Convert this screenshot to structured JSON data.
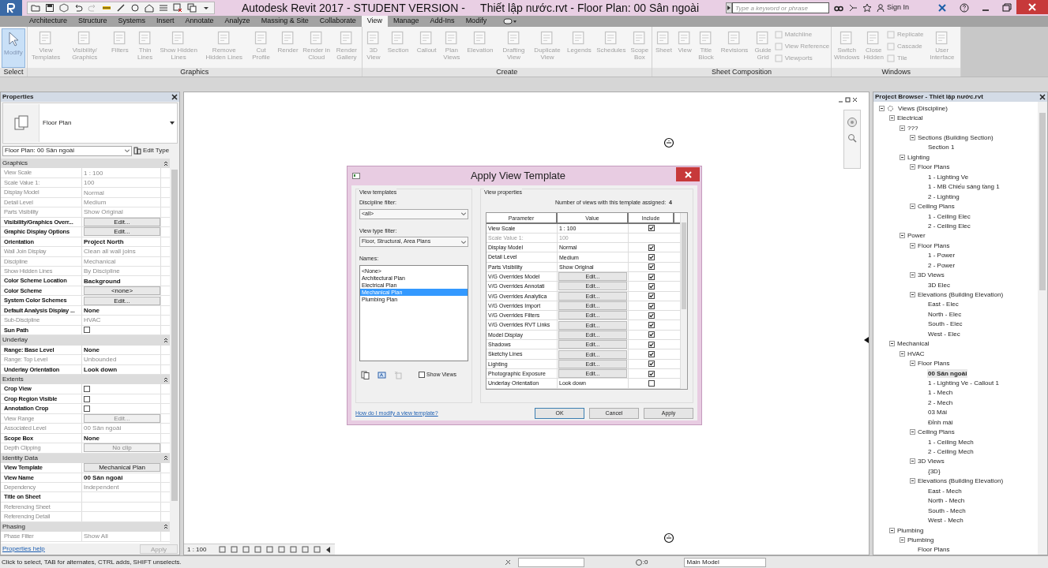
{
  "title_bar": {
    "title": "Autodesk Revit 2017 - STUDENT VERSION -     Thiết lập nước.rvt - Floor Plan: 00 Sân ngoài",
    "search_placeholder": "Type a keyword or phrase",
    "sign_in": "Sign In"
  },
  "tabs": [
    {
      "label": "Architecture",
      "selected": false
    },
    {
      "label": "Structure",
      "selected": false
    },
    {
      "label": "Systems",
      "selected": false
    },
    {
      "label": "Insert",
      "selected": false
    },
    {
      "label": "Annotate",
      "selected": false
    },
    {
      "label": "Analyze",
      "selected": false
    },
    {
      "label": "Massing & Site",
      "selected": false
    },
    {
      "label": "Collaborate",
      "selected": false
    },
    {
      "label": "View",
      "selected": true
    },
    {
      "label": "Manage",
      "selected": false
    },
    {
      "label": "Add-Ins",
      "selected": false
    },
    {
      "label": "Modify",
      "selected": false
    }
  ],
  "ribbon": [
    {
      "label": "Select",
      "tools": [
        {
          "label": "Modify",
          "kind": "large",
          "disabled": false,
          "selected": true
        }
      ]
    },
    {
      "label": "Graphics",
      "tools": [
        {
          "label": "View Templates",
          "kind": "large",
          "disabled": true,
          "selected": false
        },
        {
          "label": "Visibility/ Graphics",
          "kind": "large",
          "disabled": true,
          "selected": false
        },
        {
          "label": "Filters",
          "kind": "large",
          "disabled": true,
          "selected": false
        },
        {
          "label": "Thin Lines",
          "kind": "large",
          "disabled": true,
          "selected": false
        },
        {
          "label": "Show Hidden Lines",
          "kind": "large",
          "disabled": true,
          "selected": false
        },
        {
          "label": "Remove Hidden Lines",
          "kind": "large",
          "disabled": true,
          "selected": false
        },
        {
          "label": "Cut Profile",
          "kind": "large",
          "disabled": true,
          "selected": false
        },
        {
          "label": "Render",
          "kind": "large",
          "disabled": true,
          "selected": false
        },
        {
          "label": "Render in Cloud",
          "kind": "large",
          "disabled": true,
          "selected": false
        },
        {
          "label": "Render Gallery",
          "kind": "large",
          "disabled": true,
          "selected": false
        }
      ]
    },
    {
      "label": "Create",
      "tools": [
        {
          "label": "3D View",
          "kind": "large",
          "disabled": true,
          "selected": false
        },
        {
          "label": "Section",
          "kind": "large",
          "disabled": true,
          "selected": false
        },
        {
          "label": "Callout",
          "kind": "large",
          "disabled": true,
          "selected": false
        },
        {
          "label": "Plan Views",
          "kind": "large",
          "disabled": true,
          "selected": false
        },
        {
          "label": "Elevation",
          "kind": "large",
          "disabled": true,
          "selected": false
        },
        {
          "label": "Drafting View",
          "kind": "large",
          "disabled": true,
          "selected": false
        },
        {
          "label": "Duplicate View",
          "kind": "large",
          "disabled": true,
          "selected": false
        },
        {
          "label": "Legends",
          "kind": "large",
          "disabled": true,
          "selected": false
        },
        {
          "label": "Schedules",
          "kind": "large",
          "disabled": true,
          "selected": false
        },
        {
          "label": "Scope Box",
          "kind": "large",
          "disabled": true,
          "selected": false
        }
      ]
    },
    {
      "label": "Sheet Composition",
      "tools": [
        {
          "label": "Sheet",
          "kind": "large",
          "disabled": true,
          "selected": false
        },
        {
          "label": "View",
          "kind": "large",
          "disabled": true,
          "selected": false
        },
        {
          "label": "Title Block",
          "kind": "large",
          "disabled": true,
          "selected": false
        },
        {
          "label": "Revisions",
          "kind": "large",
          "disabled": true,
          "selected": false
        },
        {
          "label": "Guide Grid",
          "kind": "large",
          "disabled": true,
          "selected": false
        },
        {
          "label": "Matchline",
          "kind": "small",
          "disabled": true,
          "selected": false
        },
        {
          "label": "View Reference",
          "kind": "small",
          "disabled": true,
          "selected": false
        },
        {
          "label": "Viewports",
          "kind": "small",
          "disabled": true,
          "selected": false
        }
      ]
    },
    {
      "label": "Windows",
      "tools": [
        {
          "label": "Switch Windows",
          "kind": "large",
          "disabled": true,
          "selected": false
        },
        {
          "label": "Close Hidden",
          "kind": "large",
          "disabled": true,
          "selected": false
        },
        {
          "label": "Replicate",
          "kind": "small",
          "disabled": true,
          "selected": false
        },
        {
          "label": "Cascade",
          "kind": "small",
          "disabled": true,
          "selected": false
        },
        {
          "label": "Tile",
          "kind": "small",
          "disabled": true,
          "selected": false
        },
        {
          "label": "User Interface",
          "kind": "large",
          "disabled": true,
          "selected": false
        }
      ]
    }
  ],
  "properties": {
    "title": "Properties",
    "type_name": "Floor Plan",
    "instance": "Floor Plan: 00 Sân ngoài",
    "edit_type": "Edit Type",
    "help_link": "Properties help",
    "apply": "Apply",
    "groups": [
      {
        "name": "Graphics",
        "rows": [
          {
            "label": "View Scale",
            "value": "1 : 100",
            "kind": "text",
            "disabled": true
          },
          {
            "label": "Scale Value 1:",
            "value": "100",
            "kind": "text",
            "disabled": true
          },
          {
            "label": "Display Model",
            "value": "Normal",
            "kind": "text",
            "disabled": true
          },
          {
            "label": "Detail Level",
            "value": "Medium",
            "kind": "text",
            "disabled": true
          },
          {
            "label": "Parts Visibility",
            "value": "Show Original",
            "kind": "text",
            "disabled": true
          },
          {
            "label": "Visibility/Graphics Overr...",
            "value": "Edit...",
            "kind": "button",
            "disabled": false
          },
          {
            "label": "Graphic Display Options",
            "value": "Edit...",
            "kind": "button",
            "disabled": false
          },
          {
            "label": "Orientation",
            "value": "Project North",
            "kind": "text",
            "disabled": false
          },
          {
            "label": "Wall Join Display",
            "value": "Clean all wall joins",
            "kind": "text",
            "disabled": true
          },
          {
            "label": "Discipline",
            "value": "Mechanical",
            "kind": "text",
            "disabled": true
          },
          {
            "label": "Show Hidden Lines",
            "value": "By Discipline",
            "kind": "text",
            "disabled": true
          },
          {
            "label": "Color Scheme Location",
            "value": "Background",
            "kind": "text",
            "disabled": false
          },
          {
            "label": "Color Scheme",
            "value": "<none>",
            "kind": "button",
            "disabled": false
          },
          {
            "label": "System Color Schemes",
            "value": "Edit...",
            "kind": "button",
            "disabled": false
          },
          {
            "label": "Default Analysis Display ...",
            "value": "None",
            "kind": "text",
            "disabled": false
          },
          {
            "label": "Sub-Discipline",
            "value": "HVAC",
            "kind": "text",
            "disabled": true
          },
          {
            "label": "Sun Path",
            "kind": "checkbox",
            "checked": false,
            "disabled": false
          }
        ]
      },
      {
        "name": "Underlay",
        "rows": [
          {
            "label": "Range: Base Level",
            "value": "None",
            "kind": "text",
            "disabled": false
          },
          {
            "label": "Range: Top Level",
            "value": "Unbounded",
            "kind": "text",
            "disabled": true
          },
          {
            "label": "Underlay Orientation",
            "value": "Look down",
            "kind": "text",
            "disabled": false
          }
        ]
      },
      {
        "name": "Extents",
        "rows": [
          {
            "label": "Crop View",
            "kind": "checkbox",
            "checked": false,
            "disabled": false
          },
          {
            "label": "Crop Region Visible",
            "kind": "checkbox",
            "checked": false,
            "disabled": false
          },
          {
            "label": "Annotation Crop",
            "kind": "checkbox",
            "checked": false,
            "disabled": false
          },
          {
            "label": "View Range",
            "value": "Edit...",
            "kind": "button",
            "disabled": true
          },
          {
            "label": "Associated Level",
            "value": "00 Sân ngoài",
            "kind": "text",
            "disabled": true
          },
          {
            "label": "Scope Box",
            "value": "None",
            "kind": "text",
            "disabled": false
          },
          {
            "label": "Depth Clipping",
            "value": "No clip",
            "kind": "button",
            "disabled": true
          }
        ]
      },
      {
        "name": "Identity Data",
        "rows": [
          {
            "label": "View Template",
            "value": "Mechanical Plan",
            "kind": "button",
            "disabled": false
          },
          {
            "label": "View Name",
            "value": "00 Sân ngoài",
            "kind": "text",
            "disabled": false
          },
          {
            "label": "Dependency",
            "value": "Independent",
            "kind": "text",
            "disabled": true
          },
          {
            "label": "Title on Sheet",
            "kind": "text",
            "disabled": false
          },
          {
            "label": "Referencing Sheet",
            "kind": "text",
            "disabled": true
          },
          {
            "label": "Referencing Detail",
            "kind": "text",
            "disabled": true
          }
        ]
      },
      {
        "name": "Phasing",
        "rows": [
          {
            "label": "Phase Filter",
            "value": "Show All",
            "kind": "text",
            "disabled": true
          }
        ]
      }
    ]
  },
  "view_control_bar": {
    "scale": "1 : 100"
  },
  "dialog": {
    "title": "Apply View Template",
    "templates_group": "View templates",
    "discipline_label": "Discipline filter:",
    "discipline_value": "<all>",
    "view_type_label": "View type filter:",
    "view_type_value": "Floor, Structural, Area Plans",
    "names_label": "Names:",
    "names": [
      {
        "label": "<None>",
        "selected": false
      },
      {
        "label": "Architectural Plan",
        "selected": false
      },
      {
        "label": "Electrical Plan",
        "selected": false
      },
      {
        "label": "Mechanical Plan",
        "selected": true
      },
      {
        "label": "Plumbing Plan",
        "selected": false
      }
    ],
    "show_views": {
      "label": "Show Views",
      "checked": false
    },
    "properties_group": "View properties",
    "assigned_label": "Number of views with this template assigned:",
    "assigned_count": "4",
    "columns": [
      "Parameter",
      "Value",
      "Include"
    ],
    "rows": [
      {
        "parameter": "View Scale",
        "value": "1 : 100",
        "kind": "text",
        "disabled": false,
        "include": true
      },
      {
        "parameter": "Scale Value 1:",
        "value": "100",
        "kind": "text",
        "disabled": true
      },
      {
        "parameter": "Display Model",
        "value": "Normal",
        "kind": "text",
        "disabled": false,
        "include": true
      },
      {
        "parameter": "Detail Level",
        "value": "Medium",
        "kind": "text",
        "disabled": false,
        "include": true
      },
      {
        "parameter": "Parts Visibility",
        "value": "Show Original",
        "kind": "text",
        "disabled": false,
        "include": true
      },
      {
        "parameter": "V/G Overrides Model",
        "value": "Edit...",
        "kind": "button",
        "disabled": false,
        "include": true
      },
      {
        "parameter": "V/G Overrides Annotati",
        "value": "Edit...",
        "kind": "button",
        "disabled": false,
        "include": true
      },
      {
        "parameter": "V/G Overrides Analytica",
        "value": "Edit...",
        "kind": "button",
        "disabled": false,
        "include": true
      },
      {
        "parameter": "V/G Overrides Import",
        "value": "Edit...",
        "kind": "button",
        "disabled": false,
        "include": true
      },
      {
        "parameter": "V/G Overrides Filters",
        "value": "Edit...",
        "kind": "button",
        "disabled": false,
        "include": true
      },
      {
        "parameter": "V/G Overrides RVT Links",
        "value": "Edit...",
        "kind": "button",
        "disabled": false,
        "include": true
      },
      {
        "parameter": "Model Display",
        "value": "Edit...",
        "kind": "button",
        "disabled": false,
        "include": true
      },
      {
        "parameter": "Shadows",
        "value": "Edit...",
        "kind": "button",
        "disabled": false,
        "include": true
      },
      {
        "parameter": "Sketchy Lines",
        "value": "Edit...",
        "kind": "button",
        "disabled": false,
        "include": true
      },
      {
        "parameter": "Lighting",
        "value": "Edit...",
        "kind": "button",
        "disabled": false,
        "include": true
      },
      {
        "parameter": "Photographic Exposure",
        "value": "Edit...",
        "kind": "button",
        "disabled": false,
        "include": true
      },
      {
        "parameter": "Underlay Orientation",
        "value": "Look down",
        "kind": "text",
        "disabled": false,
        "include": false
      }
    ],
    "help_link": "How do I modify a view template?",
    "buttons": [
      "OK",
      "Cancel",
      "Apply"
    ]
  },
  "project_browser": {
    "title": "Project Browser - Thiết lập nước.rvt",
    "tree": [
      {
        "label": "Views (Discipline)",
        "selected": false,
        "children": [
          {
            "label": "Electrical",
            "selected": false,
            "children": [
              {
                "label": "???",
                "selected": false,
                "children": [
                  {
                    "label": "Sections (Building Section)",
                    "selected": false,
                    "children": [
                      {
                        "label": "Section 1",
                        "selected": false
                      }
                    ]
                  }
                ]
              },
              {
                "label": "Lighting",
                "selected": false,
                "children": [
                  {
                    "label": "Floor Plans",
                    "selected": false,
                    "children": [
                      {
                        "label": "1 - Lighting Ve",
                        "selected": false
                      },
                      {
                        "label": "1 - MB Chiếu sáng tầng 1",
                        "selected": false
                      },
                      {
                        "label": "2 - Lighting",
                        "selected": false
                      }
                    ]
                  },
                  {
                    "label": "Ceiling Plans",
                    "selected": false,
                    "children": [
                      {
                        "label": "1 - Ceiling Elec",
                        "selected": false
                      },
                      {
                        "label": "2 - Ceiling Elec",
                        "selected": false
                      }
                    ]
                  }
                ]
              },
              {
                "label": "Power",
                "selected": false,
                "children": [
                  {
                    "label": "Floor Plans",
                    "selected": false,
                    "children": [
                      {
                        "label": "1 - Power",
                        "selected": false
                      },
                      {
                        "label": "2 - Power",
                        "selected": false
                      }
                    ]
                  },
                  {
                    "label": "3D Views",
                    "selected": false,
                    "children": [
                      {
                        "label": "3D Elec",
                        "selected": false
                      }
                    ]
                  },
                  {
                    "label": "Elevations (Building Elevation)",
                    "selected": false,
                    "children": [
                      {
                        "label": "East - Elec",
                        "selected": false
                      },
                      {
                        "label": "North - Elec",
                        "selected": false
                      },
                      {
                        "label": "South - Elec",
                        "selected": false
                      },
                      {
                        "label": "West - Elec",
                        "selected": false
                      }
                    ]
                  }
                ]
              }
            ]
          },
          {
            "label": "Mechanical",
            "selected": false,
            "children": [
              {
                "label": "HVAC",
                "selected": false,
                "children": [
                  {
                    "label": "Floor Plans",
                    "selected": false,
                    "children": [
                      {
                        "label": "00 Sân ngoài",
                        "selected": true
                      },
                      {
                        "label": "1 - Lighting Ve - Callout 1",
                        "selected": false
                      },
                      {
                        "label": "1 - Mech",
                        "selected": false
                      },
                      {
                        "label": "2 - Mech",
                        "selected": false
                      },
                      {
                        "label": "03 Mái",
                        "selected": false
                      },
                      {
                        "label": "Đỉnh mái",
                        "selected": false
                      }
                    ]
                  },
                  {
                    "label": "Ceiling Plans",
                    "selected": false,
                    "children": [
                      {
                        "label": "1 - Ceiling Mech",
                        "selected": false
                      },
                      {
                        "label": "2 - Ceiling Mech",
                        "selected": false
                      }
                    ]
                  },
                  {
                    "label": "3D Views",
                    "selected": false,
                    "children": [
                      {
                        "label": "{3D}",
                        "selected": false
                      }
                    ]
                  },
                  {
                    "label": "Elevations (Building Elevation)",
                    "selected": false,
                    "children": [
                      {
                        "label": "East - Mech",
                        "selected": false
                      },
                      {
                        "label": "North - Mech",
                        "selected": false
                      },
                      {
                        "label": "South - Mech",
                        "selected": false
                      },
                      {
                        "label": "West - Mech",
                        "selected": false
                      }
                    ]
                  }
                ]
              }
            ]
          },
          {
            "label": "Plumbing",
            "selected": false,
            "children": [
              {
                "label": "Plumbing",
                "selected": false,
                "children": [
                  {
                    "label": "Floor Plans",
                    "selected": false
                  }
                ]
              }
            ]
          }
        ]
      }
    ]
  },
  "status_bar": {
    "message": "Click to select, TAB for alternates, CTRL adds, SHIFT unselects.",
    "count": ":0",
    "model": "Main Model"
  }
}
